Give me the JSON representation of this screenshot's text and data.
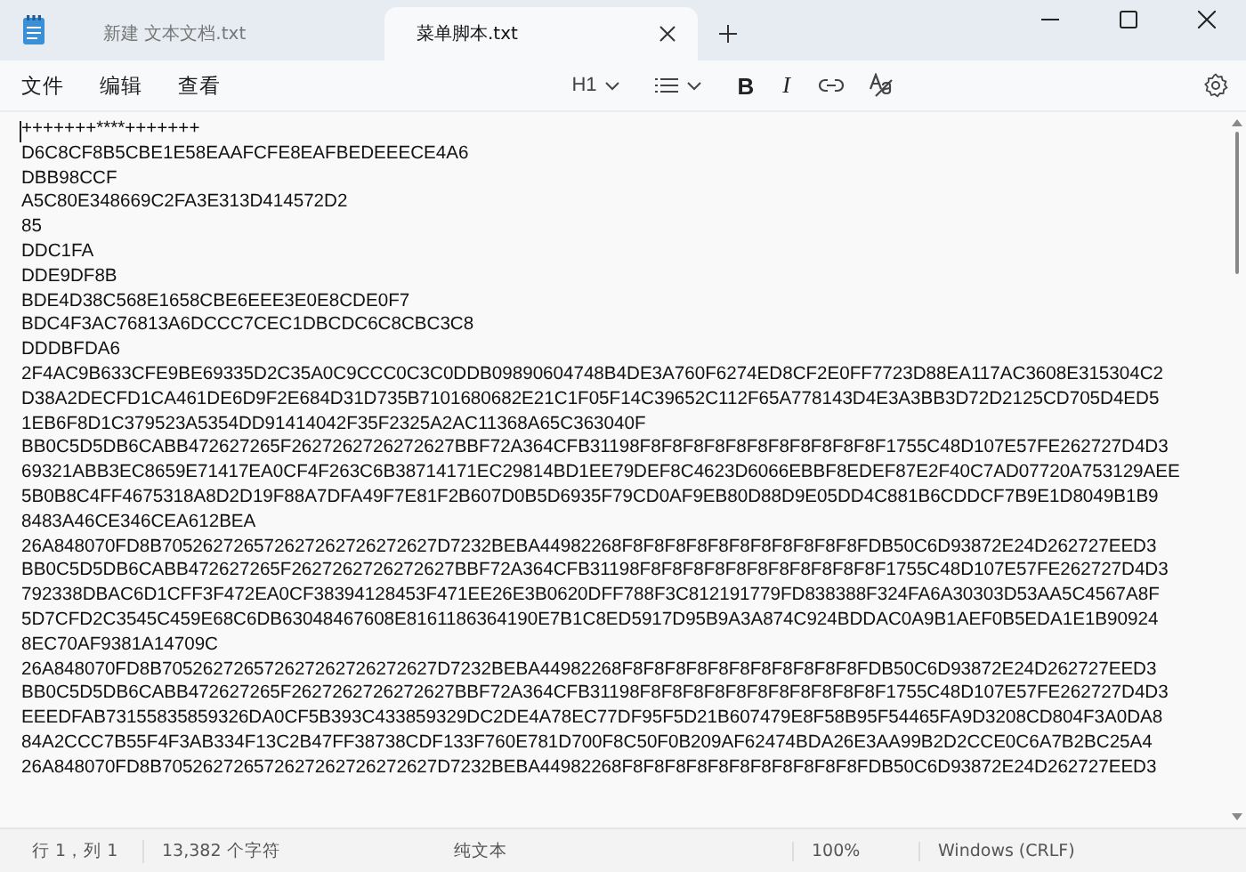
{
  "tabs": [
    {
      "title": "新建 文本文档.txt",
      "selected": false
    },
    {
      "title": "菜单脚本.txt",
      "selected": true
    }
  ],
  "menu": [
    "文件",
    "编辑",
    "查看"
  ],
  "toolbar": {
    "heading": "H1",
    "format_buttons": [
      {
        "kind": "bold",
        "label": "B"
      },
      {
        "kind": "italic",
        "label": "I"
      }
    ]
  },
  "editor": {
    "lines": [
      "+++++++****+++++++",
      "D6C8CF8B5CBE1E58EAAFCFE8EAFBEDEEECE4A6",
      "DBB98CCF",
      "A5C80E348669C2FA3E313D414572D2",
      "85",
      "DDC1FA",
      "DDE9DF8B",
      "BDE4D38C568E1658CBE6EEE3E0E8CDE0F7",
      "BDC4F3AC76813A6DCCC7CEC1DBCDC6C8CBC3C8",
      "DDDBFDA6",
      "2F4AC9B633CFE9BE69335D2C35A0C9CCC0C3C0DDB09890604748B4DE3A760F6274ED8CF2E0FF7723D88EA117AC3608E315304C2",
      "D38A2DECFD1CA461DE6D9F2E684D31D735B7101680682E21C1F05F14C39652C112F65A778143D4E3A3BB3D72D2125CD705D4ED5",
      "1EB6F8D1C379523A5354DD91414042F35F2325A2AC11368A65C363040F",
      "BB0C5D5DB6CABB472627265F2627262726272627BBF72A364CFB31198F8F8F8F8F8F8F8F8F8F8F8F1755C48D107E57FE262727D4D3",
      "69321ABB3EC8659E71417EA0CF4F263C6B38714171EC29814BD1EE79DEF8C4623D6066EBBF8EDEF87E2F40C7AD07720A753129AEE",
      "5B0B8C4FF4675318A8D2D19F88A7DFA49F7E81F2B607D0B5D6935F79CD0AF9EB80D88D9E05DD4C881B6CDDCF7B9E1D8049B1B9",
      "8483A46CE346CEA612BEA",
      "26A848070FD8B705262726572627262726272627D7232BEBA44982268F8F8F8F8F8F8F8F8F8F8F8FDB50C6D93872E24D262727EED3",
      "BB0C5D5DB6CABB472627265F2627262726272627BBF72A364CFB31198F8F8F8F8F8F8F8F8F8F8F8F1755C48D107E57FE262727D4D3",
      "792338DBAC6D1CFF3F472EA0CF38394128453F471EE26E3B0620DFF788F3C812191779FD838388F324FA6A30303D53AA5C4567A8F",
      "5D7CFD2C3545C459E68C6DB63048467608E8161186364190E7B1C8ED5917D95B9A3A874C924BDDAC0A9B1AEF0B5EDA1E1B90924",
      "8EC70AF9381A14709C",
      "26A848070FD8B705262726572627262726272627D7232BEBA44982268F8F8F8F8F8F8F8F8F8F8F8FDB50C6D93872E24D262727EED3",
      "BB0C5D5DB6CABB472627265F2627262726272627BBF72A364CFB31198F8F8F8F8F8F8F8F8F8F8F8F1755C48D107E57FE262727D4D3",
      "EEEDFAB73155835859326DA0CF5B393C433859329DC2DE4A78EC77DF95F5D21B607479E8F58B95F54465FA9D3208CD804F3A0DA8",
      "84A2CCC7B55F4F3AB334F13C2B47FF38738CDF133F760E781D700F8C50F0B209AF62474BDA26E3AA99B2D2CCE0C6A7B2BC25A4",
      "26A848070FD8B705262726572627262726272627D7232BEBA44982268F8F8F8F8F8F8F8F8F8F8F8FDB50C6D93872E24D262727EED3"
    ]
  },
  "status_bar": [
    "行 1，列 1",
    "13,382 个字符",
    "纯文本",
    "100%",
    "Windows (CRLF)"
  ]
}
